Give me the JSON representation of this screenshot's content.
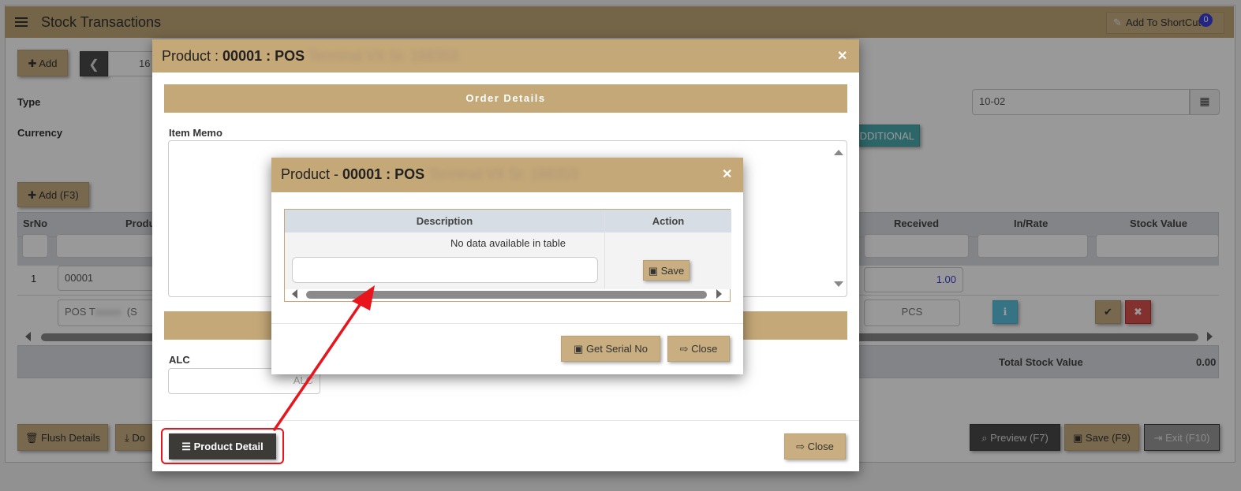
{
  "page": {
    "title": "Stock Transactions",
    "shortcut_label": "Add To ShortCut",
    "shortcut_count": "0",
    "add_label": "Add",
    "record_number": "16",
    "type_label": "Type",
    "currency_label": "Currency",
    "date_value": "10-02",
    "additional_label": "DDITIONAL",
    "add_f3_label": "Add (F3)",
    "columns": {
      "srno": "SrNo",
      "product": "Produ",
      "received": "Received",
      "in_rate": "In/Rate",
      "stock_value": "Stock Value"
    },
    "row": {
      "srno": "1",
      "code": "00001",
      "desc": "POS T",
      "desc_tail": "(S",
      "received": "1.00",
      "unit": "PCS"
    },
    "total_label": "Total Stock Value",
    "total_value": "0.00",
    "flush_label": "Flush Details",
    "download_label": "Do",
    "preview_label": "Preview (F7)",
    "save_label": "Save (F9)",
    "exit_label": "Exit (F10)"
  },
  "modal1": {
    "title_prefix": "Product : ",
    "title_code": "00001 : POS",
    "title_blurred": "Terminal VX Sr. 188353",
    "order_details": "Order Details",
    "item_memo_label": "Item Memo",
    "alc_label": "ALC",
    "alc_placeholder": "ALC",
    "product_detail_label": "Product Detail",
    "close_label": "Close"
  },
  "modal2": {
    "title_prefix": "Product - ",
    "title_code": "00001 : POS",
    "title_blurred": "Terminal VX Sr. 188353",
    "col_description": "Description",
    "col_action": "Action",
    "empty_text": "No data available in table",
    "save_label": "Save",
    "get_serial_label": "Get Serial No",
    "close_label": "Close"
  },
  "colors": {
    "accent": "#c4a878",
    "annotation": "#e8151c",
    "info": "#5bc0de",
    "danger": "#d9534f"
  }
}
